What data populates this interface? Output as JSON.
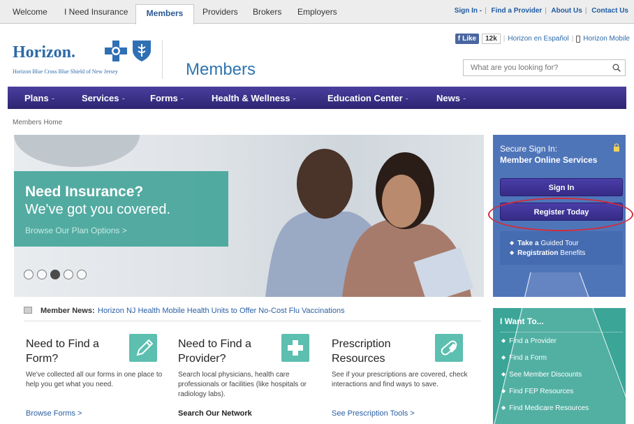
{
  "top_tabs": [
    "Welcome",
    "I Need Insurance",
    "Members",
    "Providers",
    "Brokers",
    "Employers"
  ],
  "utility_links": [
    "Sign In -",
    "Find a Provider",
    "About Us",
    "Contact Us"
  ],
  "brand": {
    "logo_text": "Horizon.",
    "logo_sub": "Horizon Blue Cross Blue Shield of New Jersey",
    "section_title": "Members",
    "accent": "#2d6aa8"
  },
  "social": {
    "like_label": "Like",
    "like_count": "12k",
    "spanish_link": "Horizon en Español",
    "mobile_link": "Horizon Mobile"
  },
  "search": {
    "placeholder": "What are you looking for?"
  },
  "main_nav": [
    "Plans",
    "Services",
    "Forms",
    "Health & Wellness",
    "Education Center",
    "News"
  ],
  "breadcrumb": "Members Home",
  "hero": {
    "title": "Need Insurance?",
    "subtitle": "We've got you covered.",
    "link": "Browse Our Plan Options >",
    "dots_total": 5,
    "active_dot": 3
  },
  "signin": {
    "title_line1": "Secure Sign In:",
    "title_line2": "Member Online Services",
    "signin_button": "Sign In",
    "register_button": "Register Today",
    "links": [
      {
        "bold": "Take a",
        "rest": " Guided Tour"
      },
      {
        "bold": "Registration",
        "rest": " Benefits"
      }
    ]
  },
  "news": {
    "label": "Member News:",
    "text": "Horizon NJ Health Mobile Health Units to Offer No-Cost Flu Vaccinations"
  },
  "cards": [
    {
      "title_line1": "Need to Find a",
      "title_line2": "Form?",
      "icon": "pencil-icon",
      "description": "We've collected all our forms in one place to help you get what you need.",
      "link": "Browse Forms >"
    },
    {
      "title_line1": "Need to Find a",
      "title_line2": "Provider?",
      "icon": "plus-icon",
      "description": "Search local physicians, health care professionals or facilities (like hospitals or radiology labs).",
      "bold_label": "Search Our Network"
    },
    {
      "title_line1": "Prescription",
      "title_line2": "Resources",
      "icon": "pill-icon",
      "description": "See if your prescriptions are covered, check interactions and find ways to save.",
      "link": "See Prescription Tools >"
    }
  ],
  "iwant": {
    "title": "I Want To...",
    "items": [
      "Find a Provider",
      "Find a Form",
      "See Member Discounts",
      "Find FEP Resources",
      "Find Medicare Resources"
    ]
  },
  "colors": {
    "nav_purple": "#362b86",
    "teal": "#3ba597",
    "signin_blue": "#4f75b9",
    "highlight_red": "#d22c3a"
  }
}
